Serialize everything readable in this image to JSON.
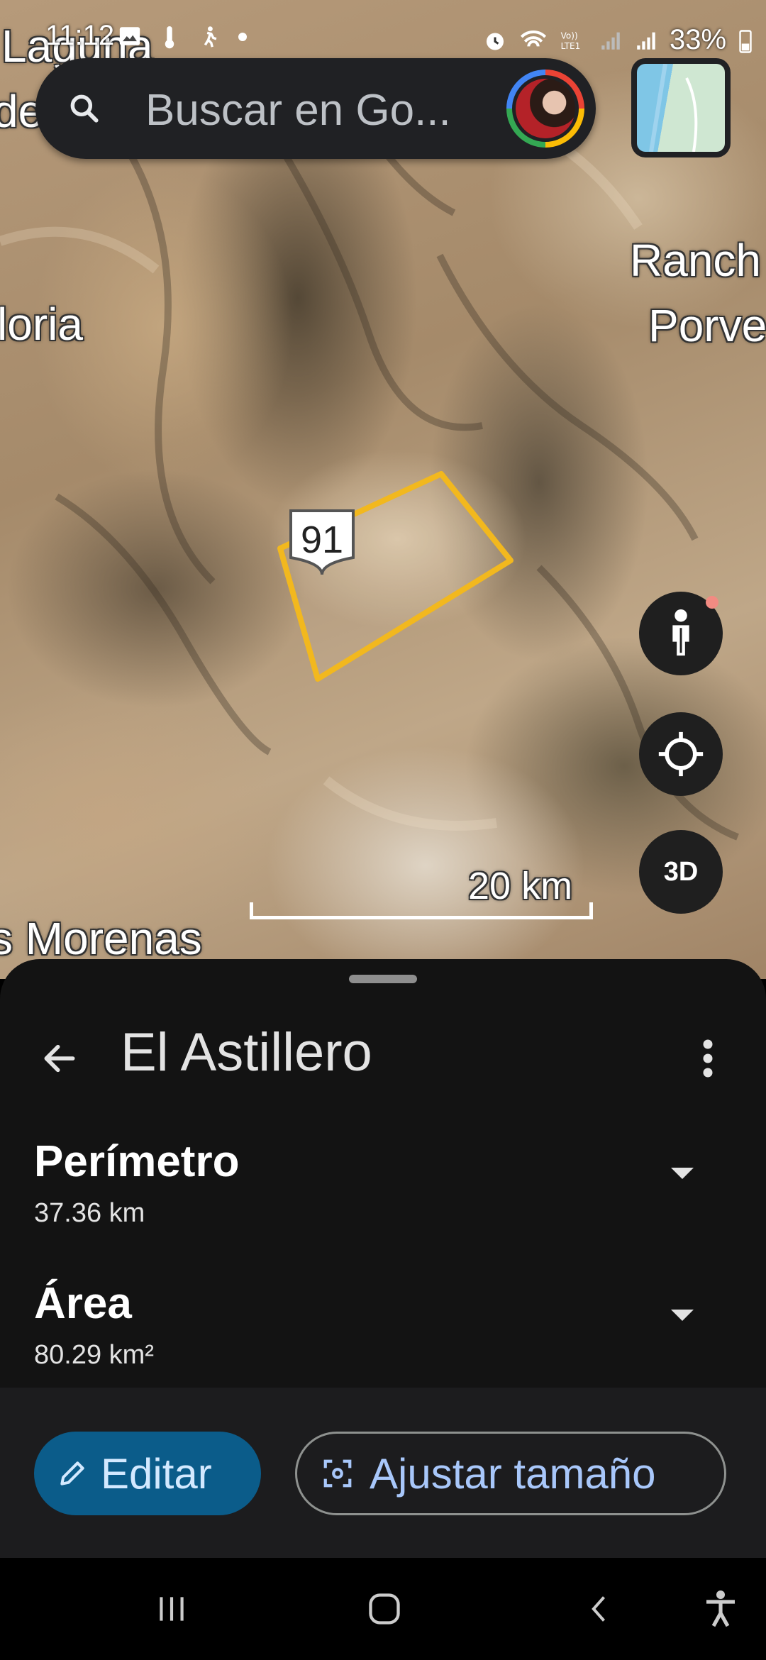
{
  "status_bar": {
    "time": "11:12",
    "battery": "33%"
  },
  "map": {
    "labels": {
      "top_left_1": "Laguna",
      "top_left_2": "de",
      "left": "loria",
      "right_1": "Ranch",
      "right_2": "Porve",
      "bottom_left": "s Morenas"
    },
    "road_shield": "91",
    "scale_label": "20 km",
    "btn_3d": "3D",
    "polygon_color": "#f2b81e"
  },
  "search": {
    "placeholder": "Buscar en Go..."
  },
  "sheet": {
    "title": "El Astillero",
    "metrics": [
      {
        "label": "Perímetro",
        "value": "37.36 km"
      },
      {
        "label": "Área",
        "value": "80.29 km²"
      }
    ],
    "edit_label": "Editar",
    "fit_label": "Ajustar tamaño"
  },
  "icons": {
    "search": "search-icon",
    "pegman": "street-view-icon",
    "location": "my-location-icon",
    "back": "arrow-back-icon",
    "more": "more-vert-icon",
    "edit": "pencil-icon",
    "fit": "fit-screen-icon"
  }
}
